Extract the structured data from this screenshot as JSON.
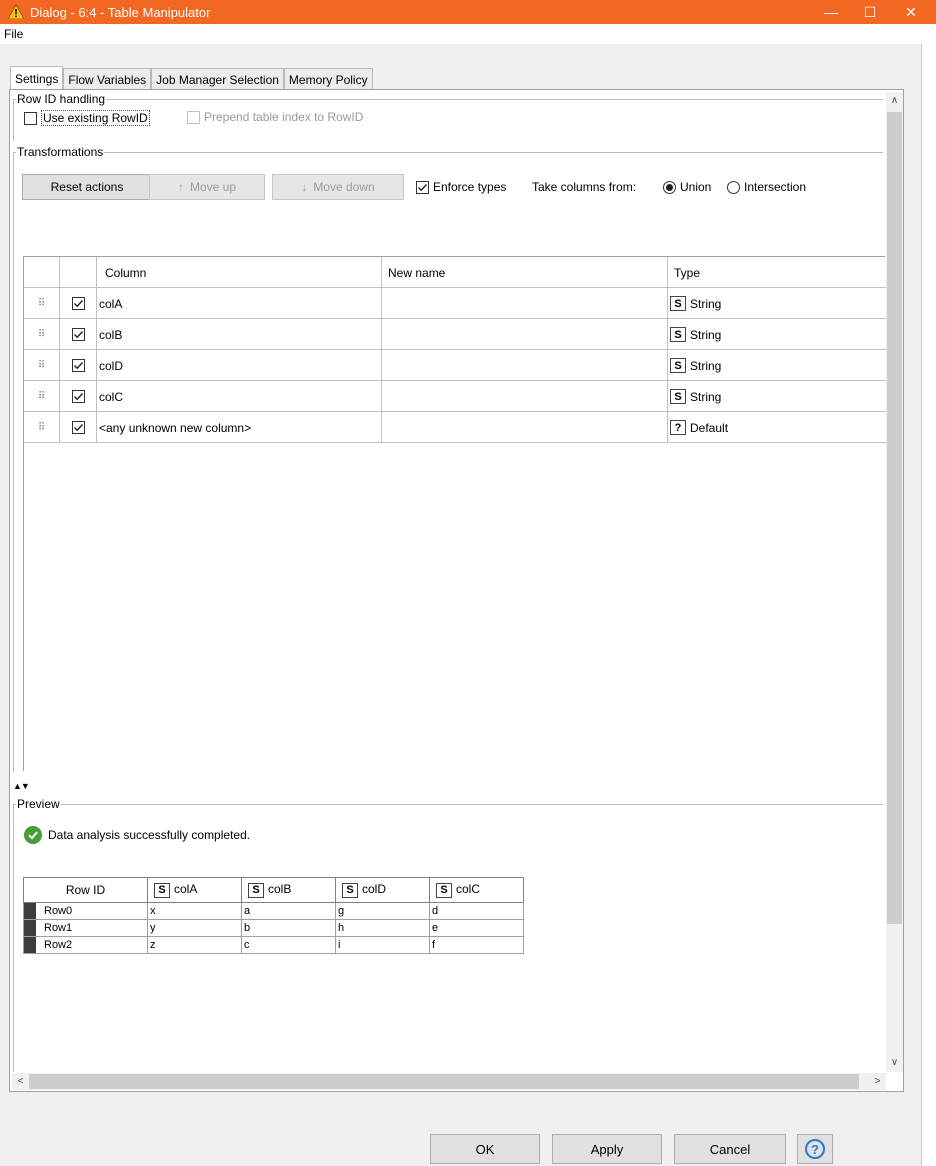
{
  "window": {
    "title": "Dialog - 6:4 - Table Manipulator",
    "minimize": "—",
    "maximize": "☐",
    "close": "✕"
  },
  "menu": {
    "file": "File"
  },
  "tabs": [
    {
      "label": "Settings"
    },
    {
      "label": "Flow Variables"
    },
    {
      "label": "Job Manager Selection"
    },
    {
      "label": "Memory Policy"
    }
  ],
  "row_id_handling": {
    "legend": "Row ID handling",
    "use_existing_label": "Use existing RowID",
    "use_existing_checked": false,
    "prepend_label": "Prepend table index to RowID",
    "prepend_enabled": false
  },
  "transformations": {
    "legend": "Transformations",
    "reset_label": "Reset actions",
    "move_up_label": "Move up",
    "move_down_label": "Move down",
    "enforce_types_label": "Enforce types",
    "enforce_types_checked": true,
    "take_columns_label": "Take columns from:",
    "union_label": "Union",
    "intersection_label": "Intersection",
    "selected_mode": "Union",
    "headers": {
      "column": "Column",
      "new_name": "New name",
      "type": "Type"
    },
    "rows": [
      {
        "column": "colA",
        "new_name": "",
        "type_icon": "S",
        "type": "String",
        "checked": true
      },
      {
        "column": "colB",
        "new_name": "",
        "type_icon": "S",
        "type": "String",
        "checked": true
      },
      {
        "column": "colD",
        "new_name": "",
        "type_icon": "S",
        "type": "String",
        "checked": true
      },
      {
        "column": "colC",
        "new_name": "",
        "type_icon": "S",
        "type": "String",
        "checked": true
      },
      {
        "column": "<any unknown new column>",
        "new_name": "",
        "type_icon": "?",
        "type": "Default",
        "checked": true
      }
    ]
  },
  "preview": {
    "legend": "Preview",
    "status": "Data analysis successfully completed.",
    "headers": [
      "Row ID",
      "colA",
      "colB",
      "colD",
      "colC"
    ],
    "header_type_icon": "S",
    "rows": [
      {
        "id": "Row0",
        "cells": [
          "x",
          "a",
          "g",
          "d"
        ]
      },
      {
        "id": "Row1",
        "cells": [
          "y",
          "b",
          "h",
          "e"
        ]
      },
      {
        "id": "Row2",
        "cells": [
          "z",
          "c",
          "i",
          "f"
        ]
      }
    ]
  },
  "buttons": {
    "ok": "OK",
    "apply": "Apply",
    "cancel": "Cancel",
    "help": "?"
  },
  "colors": {
    "title_bar": "#f26822",
    "success": "#4a9c3a",
    "help": "#2a7ad6"
  }
}
